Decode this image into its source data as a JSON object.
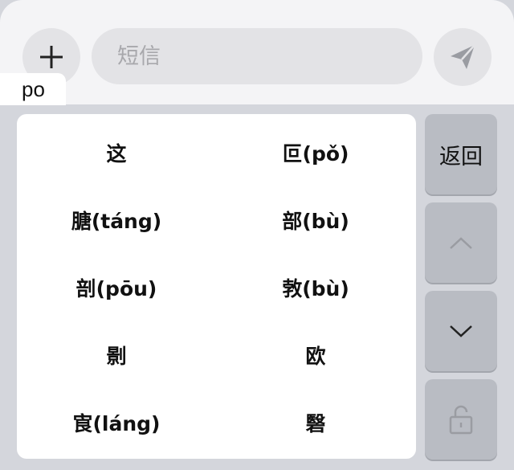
{
  "compose": {
    "placeholder": "短信"
  },
  "ime": {
    "composing_text": "po",
    "candidates": [
      "这",
      "叵(pǒ)",
      "膅(táng)",
      "部(bù)",
      "剖(pōu)",
      "㪍(bù)",
      "㔀",
      "欧",
      "㝗(láng)",
      "䃜"
    ],
    "side_keys": {
      "return_label": "返回"
    }
  },
  "colors": {
    "keyboard_bg": "#d4d6dc",
    "key_bg": "#b9bcc3",
    "panel_bg": "#ffffff",
    "icon_gray": "#9a9ca2",
    "dark_icon": "#222222"
  },
  "icons": {
    "plus": "plus-icon",
    "send": "send-icon",
    "up": "chevron-up-icon",
    "down": "chevron-down-icon",
    "lock": "unlock-icon"
  }
}
